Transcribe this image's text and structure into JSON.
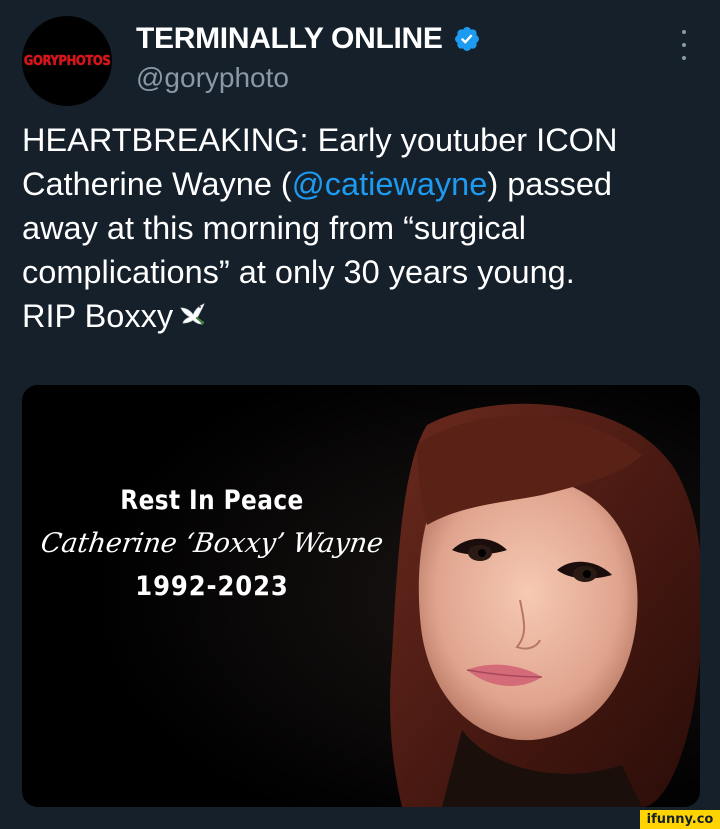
{
  "author": {
    "display_name": "TERMINALLY ONLINE",
    "handle": "@goryphoto",
    "avatar_text": "GORYPHOTOS",
    "verified_color": "#1d9bf0"
  },
  "tweet": {
    "text_before_mention": "HEARTBREAKING: Early youtuber ICON\nCatherine Wayne (",
    "mention": "@catiewayne",
    "text_after_mention": ") passed\naway at this morning from “surgical\ncomplications” at only 30 years young.\nRIP Boxxy",
    "emoji": "dove-icon"
  },
  "media": {
    "caption_title": "Rest In Peace",
    "caption_name": "Catherine ‘Boxxy’ Wayne",
    "caption_dates": "1992-2023"
  },
  "watermark": "ifunny.co",
  "colors": {
    "background": "#15202b",
    "text": "#ffffff",
    "secondary": "#8b98a5",
    "link": "#1d9bf0"
  }
}
